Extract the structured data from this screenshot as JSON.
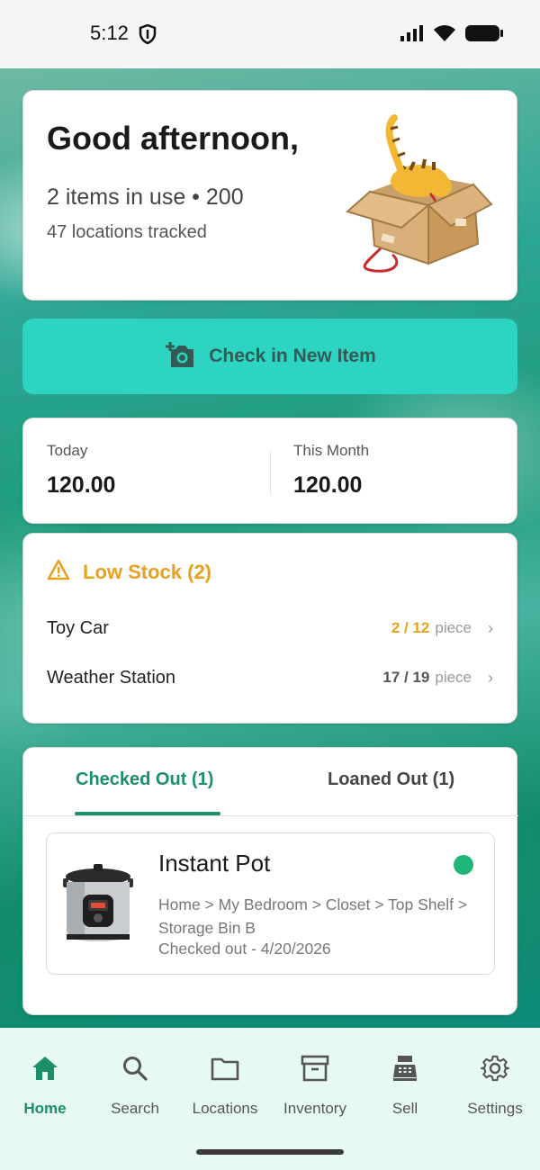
{
  "status_bar": {
    "time": "5:12"
  },
  "greeting": {
    "title": "Good afternoon,",
    "summary": "2 items in use • 200",
    "locations": "47 locations tracked"
  },
  "checkin": {
    "label": "Check in New Item"
  },
  "stats": {
    "today_label": "Today",
    "today_value": "120.00",
    "month_label": "This Month",
    "month_value": "120.00"
  },
  "low_stock": {
    "title": "Low Stock (2)",
    "items": [
      {
        "name": "Toy Car",
        "count": "2 / 12",
        "unit": "piece",
        "count_color": "#e9a01d"
      },
      {
        "name": "Weather Station",
        "count": "17 / 19",
        "unit": "piece",
        "count_color": "#555555"
      }
    ]
  },
  "checked_out": {
    "tabs": [
      {
        "label": "Checked Out (1)",
        "active": true
      },
      {
        "label": "Loaned Out (1)",
        "active": false
      }
    ],
    "item": {
      "name": "Instant Pot",
      "path": "Home > My Bedroom > Closet > Top Shelf > Storage Bin B",
      "status": "Checked out - 4/20/2026",
      "status_color": "#1fb678"
    }
  },
  "nav": {
    "items": [
      {
        "label": "Home",
        "icon": "home-icon",
        "active": true
      },
      {
        "label": "Search",
        "icon": "search-icon",
        "active": false
      },
      {
        "label": "Locations",
        "icon": "folder-icon",
        "active": false
      },
      {
        "label": "Inventory",
        "icon": "archive-icon",
        "active": false
      },
      {
        "label": "Sell",
        "icon": "cash-register-icon",
        "active": false
      },
      {
        "label": "Settings",
        "icon": "gear-icon",
        "active": false
      }
    ]
  },
  "colors": {
    "accent": "#1b8f6a",
    "checkin_bg": "#2dd4c2",
    "warning": "#e9a01d",
    "nav_bg": "#e7faf2"
  }
}
